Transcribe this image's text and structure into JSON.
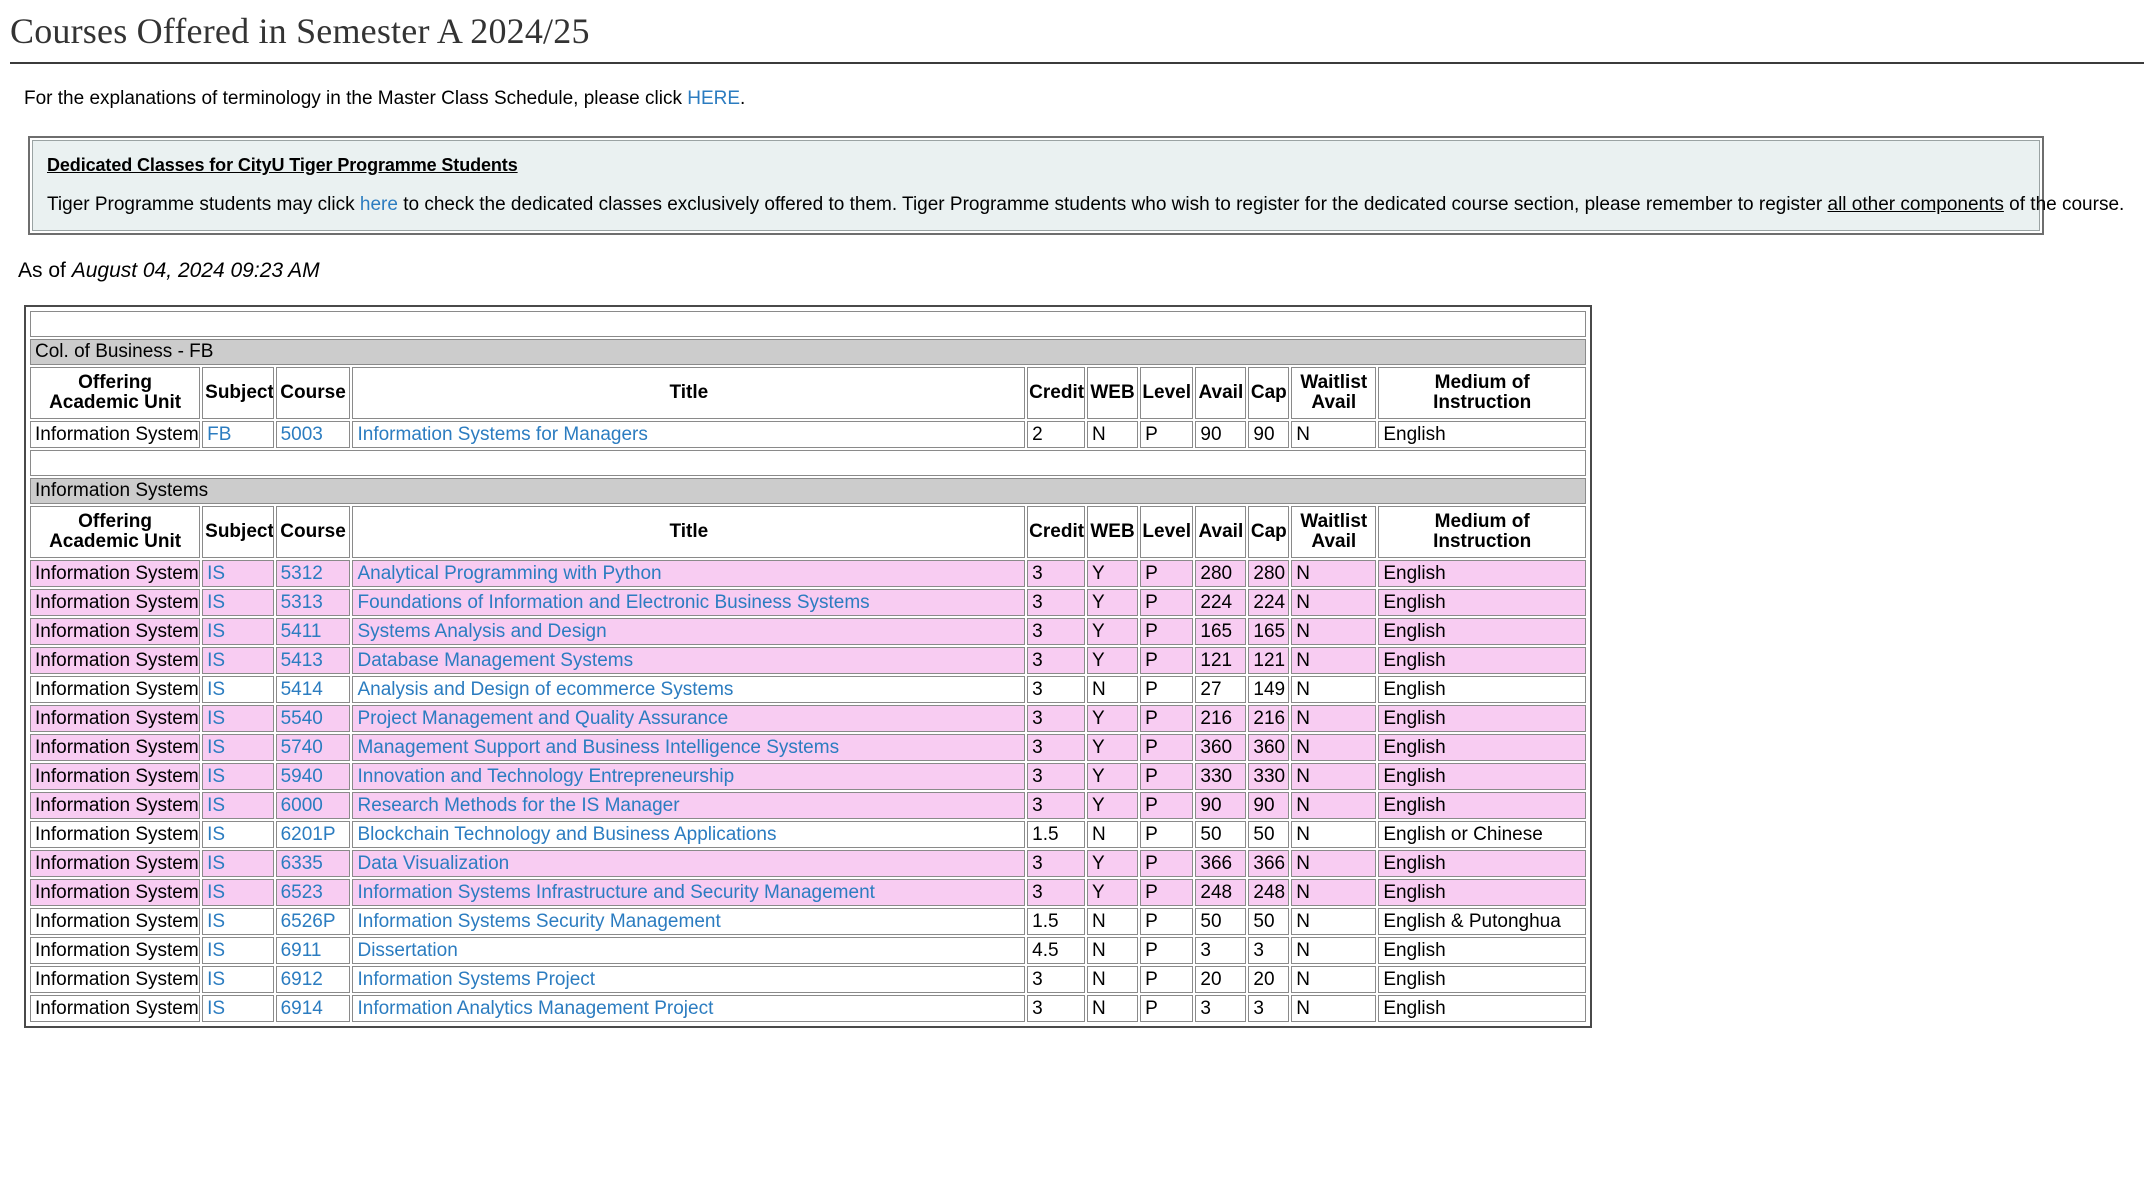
{
  "header": {
    "title": "Courses Offered in Semester A 2024/25"
  },
  "intro": {
    "text_before": "For the explanations of terminology in the Master Class Schedule, please click ",
    "link_label": "HERE",
    "text_after": "."
  },
  "notice": {
    "heading": "Dedicated Classes for CityU Tiger Programme Students",
    "body_part1": "Tiger Programme students may click ",
    "body_link": "here",
    "body_part2": " to check the dedicated classes exclusively offered to them. Tiger Programme students who wish to register for the dedicated course section, please remember to register ",
    "body_underlined": "all other components",
    "body_part3": " of the course."
  },
  "as_of": {
    "label": "As of ",
    "date": "August 04, 2024 09:23 AM"
  },
  "table": {
    "columns": [
      "Offering Academic Unit",
      "Subject",
      "Course",
      "Title",
      "Credit",
      "WEB",
      "Level",
      "Avail",
      "Cap",
      "Waitlist Avail",
      "Medium of Instruction"
    ],
    "columns_line1": [
      "Offering",
      "Subject",
      "Course",
      "Title",
      "Credit",
      "WEB",
      "Level",
      "Avail",
      "Cap",
      "Waitlist",
      "Medium of"
    ],
    "columns_line2": [
      "Academic Unit",
      "",
      "",
      "",
      "",
      "",
      "",
      "",
      "",
      "Avail",
      "Instruction"
    ],
    "sections": [
      {
        "banner": "Col. of Business - FB",
        "rows": [
          {
            "unit": "Information Systems",
            "subject": "FB",
            "course": "5003",
            "title": "Information Systems for Managers",
            "credit": "2",
            "web": "N",
            "level": "P",
            "avail": "90",
            "cap": "90",
            "waitlist": "N",
            "medium": "English",
            "highlight": false
          }
        ]
      },
      {
        "banner": "Information Systems",
        "rows": [
          {
            "unit": "Information Systems",
            "subject": "IS",
            "course": "5312",
            "title": "Analytical Programming with Python",
            "credit": "3",
            "web": "Y",
            "level": "P",
            "avail": "280",
            "cap": "280",
            "waitlist": "N",
            "medium": "English",
            "highlight": true
          },
          {
            "unit": "Information Systems",
            "subject": "IS",
            "course": "5313",
            "title": "Foundations of Information and Electronic Business Systems",
            "credit": "3",
            "web": "Y",
            "level": "P",
            "avail": "224",
            "cap": "224",
            "waitlist": "N",
            "medium": "English",
            "highlight": true
          },
          {
            "unit": "Information Systems",
            "subject": "IS",
            "course": "5411",
            "title": "Systems Analysis and Design",
            "credit": "3",
            "web": "Y",
            "level": "P",
            "avail": "165",
            "cap": "165",
            "waitlist": "N",
            "medium": "English",
            "highlight": true
          },
          {
            "unit": "Information Systems",
            "subject": "IS",
            "course": "5413",
            "title": "Database Management Systems",
            "credit": "3",
            "web": "Y",
            "level": "P",
            "avail": "121",
            "cap": "121",
            "waitlist": "N",
            "medium": "English",
            "highlight": true
          },
          {
            "unit": "Information Systems",
            "subject": "IS",
            "course": "5414",
            "title": "Analysis and Design of ecommerce Systems",
            "credit": "3",
            "web": "N",
            "level": "P",
            "avail": "27",
            "cap": "149",
            "waitlist": "N",
            "medium": "English",
            "highlight": false
          },
          {
            "unit": "Information Systems",
            "subject": "IS",
            "course": "5540",
            "title": "Project Management and Quality Assurance",
            "credit": "3",
            "web": "Y",
            "level": "P",
            "avail": "216",
            "cap": "216",
            "waitlist": "N",
            "medium": "English",
            "highlight": true
          },
          {
            "unit": "Information Systems",
            "subject": "IS",
            "course": "5740",
            "title": "Management Support and Business Intelligence Systems",
            "credit": "3",
            "web": "Y",
            "level": "P",
            "avail": "360",
            "cap": "360",
            "waitlist": "N",
            "medium": "English",
            "highlight": true
          },
          {
            "unit": "Information Systems",
            "subject": "IS",
            "course": "5940",
            "title": "Innovation and Technology Entrepreneurship",
            "credit": "3",
            "web": "Y",
            "level": "P",
            "avail": "330",
            "cap": "330",
            "waitlist": "N",
            "medium": "English",
            "highlight": true
          },
          {
            "unit": "Information Systems",
            "subject": "IS",
            "course": "6000",
            "title": "Research Methods for the IS Manager",
            "credit": "3",
            "web": "Y",
            "level": "P",
            "avail": "90",
            "cap": "90",
            "waitlist": "N",
            "medium": "English",
            "highlight": true
          },
          {
            "unit": "Information Systems",
            "subject": "IS",
            "course": "6201P",
            "title": "Blockchain Technology and Business Applications",
            "credit": "1.5",
            "web": "N",
            "level": "P",
            "avail": "50",
            "cap": "50",
            "waitlist": "N",
            "medium": "English or Chinese",
            "highlight": false
          },
          {
            "unit": "Information Systems",
            "subject": "IS",
            "course": "6335",
            "title": "Data Visualization",
            "credit": "3",
            "web": "Y",
            "level": "P",
            "avail": "366",
            "cap": "366",
            "waitlist": "N",
            "medium": "English",
            "highlight": true
          },
          {
            "unit": "Information Systems",
            "subject": "IS",
            "course": "6523",
            "title": "Information Systems Infrastructure and Security Management",
            "credit": "3",
            "web": "Y",
            "level": "P",
            "avail": "248",
            "cap": "248",
            "waitlist": "N",
            "medium": "English",
            "highlight": true
          },
          {
            "unit": "Information Systems",
            "subject": "IS",
            "course": "6526P",
            "title": "Information Systems Security Management",
            "credit": "1.5",
            "web": "N",
            "level": "P",
            "avail": "50",
            "cap": "50",
            "waitlist": "N",
            "medium": "English & Putonghua",
            "highlight": false
          },
          {
            "unit": "Information Systems",
            "subject": "IS",
            "course": "6911",
            "title": "Dissertation",
            "credit": "4.5",
            "web": "N",
            "level": "P",
            "avail": "3",
            "cap": "3",
            "waitlist": "N",
            "medium": "English",
            "highlight": false
          },
          {
            "unit": "Information Systems",
            "subject": "IS",
            "course": "6912",
            "title": "Information Systems Project",
            "credit": "3",
            "web": "N",
            "level": "P",
            "avail": "20",
            "cap": "20",
            "waitlist": "N",
            "medium": "English",
            "highlight": false
          },
          {
            "unit": "Information Systems",
            "subject": "IS",
            "course": "6914",
            "title": "Information Analytics Management Project",
            "credit": "3",
            "web": "N",
            "level": "P",
            "avail": "3",
            "cap": "3",
            "waitlist": "N",
            "medium": "English",
            "highlight": false
          }
        ]
      }
    ]
  },
  "colors": {
    "link": "#2b7cc0",
    "highlight_row": "#f8ccf2",
    "banner": "#cccccc",
    "notice_bg": "#eaf1f1"
  }
}
